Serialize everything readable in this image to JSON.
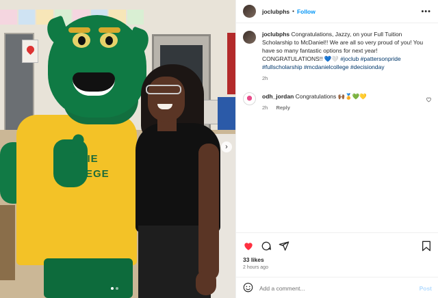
{
  "post": {
    "author": "joclubphs",
    "follow_label": "Follow",
    "separator": "•",
    "more_icon": "more-horizontal-icon"
  },
  "caption": {
    "author": "joclubphs",
    "text": "Congratulations, Jazzy, on your Full Tuition Scholarship to McDaniel!! We are all so very proud of you! You have so many fantastic options for next year! CONGRATULATIONS!! 💙🤍",
    "hashtags": "#joclub #pattersonpride #fullscholarship #mcdanielcollege #decisionday",
    "time": "2h"
  },
  "comments": [
    {
      "author": "odh_jordan",
      "text": "Congratulations 🙌🏾🏅💚💛",
      "time": "2h",
      "reply_label": "Reply"
    }
  ],
  "photo": {
    "shirt_text_line1": "DANIE",
    "shirt_text_line2": "OLLEGE",
    "carousel_count": 2,
    "carousel_active": 0
  },
  "actions": {
    "liked": true,
    "like_color": "#ff3040",
    "likes_label": "33 likes",
    "time_ago": "2 hours ago"
  },
  "composer": {
    "placeholder": "Add a comment...",
    "post_label": "Post"
  },
  "colors": {
    "link_blue": "#0095f6",
    "hashtag_blue": "#00376b",
    "muted": "#737373"
  }
}
